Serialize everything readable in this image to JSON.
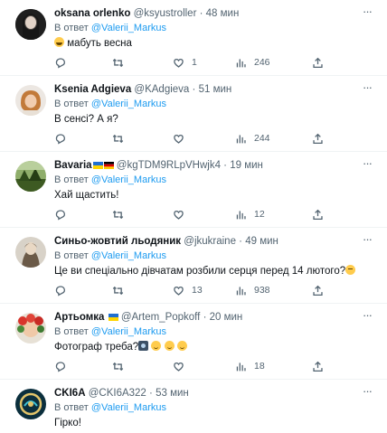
{
  "tweets": [
    {
      "name": "oksana orlenko",
      "handle": "@ksyustroller",
      "time": "48 мин",
      "reply_prefix": "В ответ",
      "mention": "@Valerii_Markus",
      "text": "мабуть весна",
      "emoji_before": "grinning-face",
      "replies": "",
      "retweets": "",
      "likes": "1",
      "views": "246",
      "avatar_color": "#3c3c3c"
    },
    {
      "name": "Ksenia Adgieva",
      "handle": "@KAdgieva",
      "time": "51 мин",
      "reply_prefix": "В ответ",
      "mention": "@Valerii_Markus",
      "text": "В сенсі? А я?",
      "replies": "",
      "retweets": "",
      "likes": "",
      "views": "244",
      "avatar_color": "#d9a57a"
    },
    {
      "name": "Bavaria",
      "flags": [
        "ukraine-flag",
        "germany-flag"
      ],
      "handle": "@kgTDM9RLpVHwjk4",
      "time": "19 мин",
      "reply_prefix": "В ответ",
      "mention": "@Valerii_Markus",
      "text": "Хай щастить!",
      "replies": "",
      "retweets": "",
      "likes": "",
      "views": "12",
      "avatar_color": "#4a6b2e"
    },
    {
      "name": "Синьо-жовтий льодяник",
      "handle": "@jkukraine",
      "time": "49 мин",
      "reply_prefix": "В ответ",
      "mention": "@Valerii_Markus",
      "text": "Це ви спеціально дівчатам розбили серця перед 14 лютого?",
      "emoji_after": "pensive-face",
      "replies": "",
      "retweets": "",
      "likes": "13",
      "views": "938",
      "avatar_color": "#b7b0a4"
    },
    {
      "name": "Артьомка",
      "flags": [
        "ukraine-flag"
      ],
      "handle": "@Artem_Popkoff",
      "time": "20 мин",
      "reply_prefix": "В ответ",
      "mention": "@Valerii_Markus",
      "text": "Фотограф треба?",
      "emoji_after": "camera-smiley-smiley-smiley",
      "replies": "",
      "retweets": "",
      "likes": "",
      "views": "18",
      "avatar_color": "#c7302c"
    },
    {
      "name": "CKI6A",
      "handle": "@CKI6A322",
      "time": "53 мин",
      "reply_prefix": "В ответ",
      "mention": "@Valerii_Markus",
      "text": "Гірко!",
      "avatar_color": "#0e3d4f"
    }
  ],
  "separator": "·",
  "colors": {
    "accent": "#1d9bf0",
    "muted": "#536471",
    "text": "#0f1419",
    "border": "#eff3f4"
  }
}
